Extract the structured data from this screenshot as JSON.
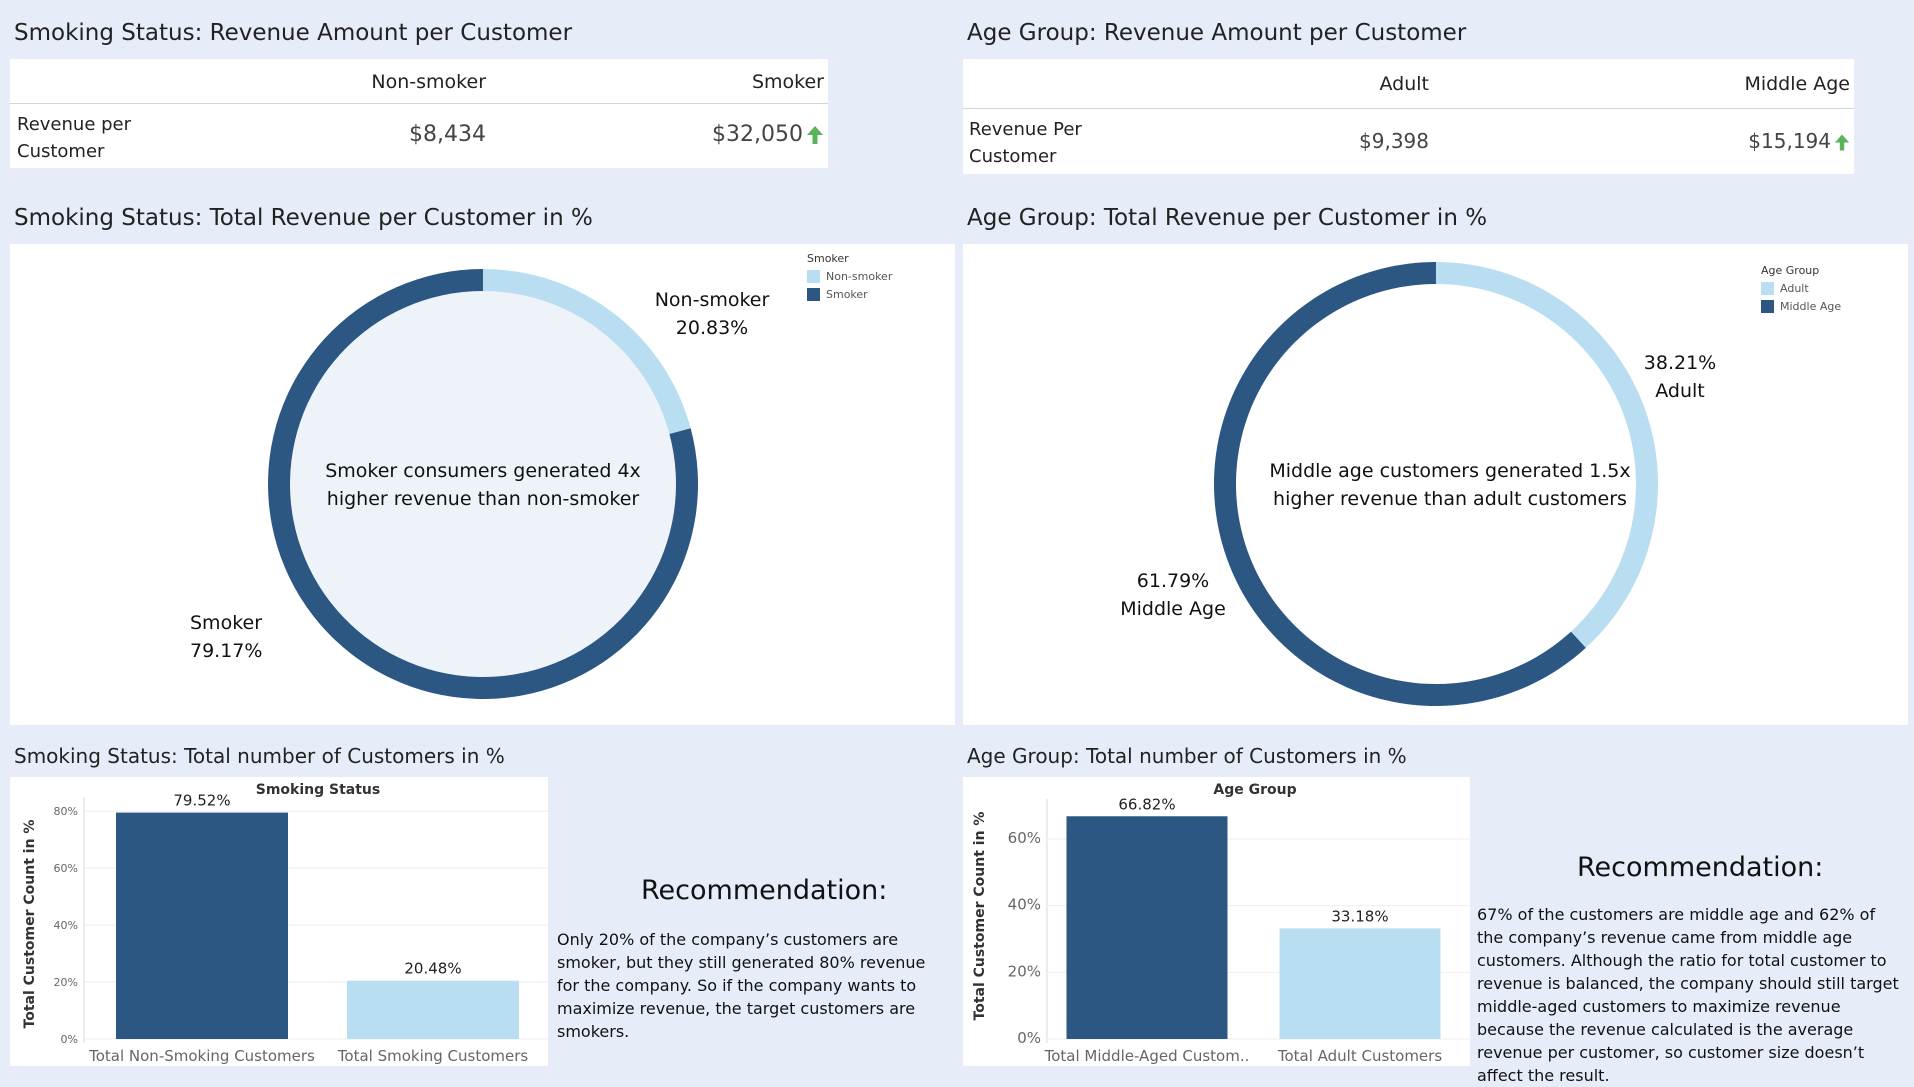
{
  "colors": {
    "dark": "#2b5782",
    "light": "#b9ddf1",
    "up": "#5bb35b",
    "bg": "#e6edf8"
  },
  "smoking_rev_table": {
    "title": "Smoking Status: Revenue Amount per Customer",
    "col1": "Non-smoker",
    "col2": "Smoker",
    "row_label_line1": "Revenue per",
    "row_label_line2": "Customer",
    "val1": "$8,434",
    "val2": "$32,050",
    "trend_icon": "up-arrow-icon"
  },
  "age_rev_table": {
    "title": "Age Group: Revenue Amount per Customer",
    "col1": "Adult",
    "col2": "Middle Age",
    "row_label_line1": "Revenue Per",
    "row_label_line2": "Customer",
    "val1": "$9,398",
    "val2": "$15,194",
    "trend_icon": "up-arrow-icon"
  },
  "smoking_donut": {
    "title": "Smoking Status: Total Revenue per Customer in %",
    "legend_title": "Smoker",
    "legend": [
      "Non-smoker",
      "Smoker"
    ],
    "center_line1": "Smoker consumers generated 4x",
    "center_line2": "higher revenue than non-smoker",
    "label_a_name": "Non-smoker",
    "label_a_value": "20.83%",
    "label_b_name": "Smoker",
    "label_b_value": "79.17%"
  },
  "age_donut": {
    "title": "Age Group: Total Revenue per Customer in %",
    "legend_title": "Age Group",
    "legend": [
      "Adult",
      "Middle Age"
    ],
    "center_line1": "Middle age customers generated 1.5x",
    "center_line2": "higher revenue than adult customers",
    "label_a_name": "Adult",
    "label_a_value": "38.21%",
    "label_b_name": "Middle Age",
    "label_b_value": "61.79%"
  },
  "smoking_bar": {
    "title": "Smoking Status: Total number of Customers in %",
    "chart_title": "Smoking Status",
    "ylabel": "Total Customer Count in %"
  },
  "age_bar": {
    "title": "Age Group: Total number of Customers in %",
    "chart_title": "Age Group",
    "ylabel": "Total Customer Count in %"
  },
  "reco_smoking": {
    "title": "Recommendation:",
    "body": "Only 20% of the company’s customers are smoker, but they still generated 80% revenue for the company. So if the company wants to maximize revenue, the target customers are smokers."
  },
  "reco_age": {
    "title": "Recommendation:",
    "body": "67% of the customers are middle age and 62% of the company’s revenue came from middle age customers. Although the ratio for total customer to revenue is balanced, the company should still target middle-aged customers to maximize revenue because the revenue calculated is the average revenue per customer, so customer size doesn’t affect the result."
  },
  "chart_data": [
    {
      "type": "table",
      "title": "Smoking Status: Revenue Amount per Customer",
      "columns": [
        "Non-smoker",
        "Smoker"
      ],
      "rows": [
        {
          "label": "Revenue per Customer",
          "values": [
            8434,
            32050
          ]
        }
      ]
    },
    {
      "type": "table",
      "title": "Age Group: Revenue Amount per Customer",
      "columns": [
        "Adult",
        "Middle Age"
      ],
      "rows": [
        {
          "label": "Revenue Per Customer",
          "values": [
            9398,
            15194
          ]
        }
      ]
    },
    {
      "type": "pie",
      "title": "Smoking Status: Total Revenue per Customer in %",
      "legend_title": "Smoker",
      "categories": [
        "Non-smoker",
        "Smoker"
      ],
      "values": [
        20.83,
        79.17
      ],
      "legend_position": "top-right"
    },
    {
      "type": "pie",
      "title": "Age Group: Total Revenue per Customer in %",
      "legend_title": "Age Group",
      "categories": [
        "Adult",
        "Middle Age"
      ],
      "values": [
        38.21,
        61.79
      ],
      "legend_position": "top-right"
    },
    {
      "type": "bar",
      "title": "Smoking Status",
      "categories": [
        "Total Non-Smoking Customers",
        "Total Smoking Customers"
      ],
      "values": [
        79.52,
        20.48
      ],
      "value_labels": [
        "79.52%",
        "20.48%"
      ],
      "ylabel": "Total Customer Count in %",
      "ylim": [
        0,
        85
      ],
      "yticks": [
        0,
        20,
        40,
        60,
        80
      ],
      "ytick_labels": [
        "0%",
        "20%",
        "40%",
        "60%",
        "80%"
      ],
      "grid": true
    },
    {
      "type": "bar",
      "title": "Age Group",
      "categories": [
        "Total Middle-Aged Custom..",
        "Total Adult Customers"
      ],
      "values": [
        66.82,
        33.18
      ],
      "value_labels": [
        "66.82%",
        "33.18%"
      ],
      "ylabel": "Total Customer Count in %",
      "ylim": [
        0,
        72
      ],
      "yticks": [
        0,
        20,
        40,
        60
      ],
      "ytick_labels": [
        "0%",
        "20%",
        "40%",
        "60%"
      ],
      "grid": true
    }
  ]
}
